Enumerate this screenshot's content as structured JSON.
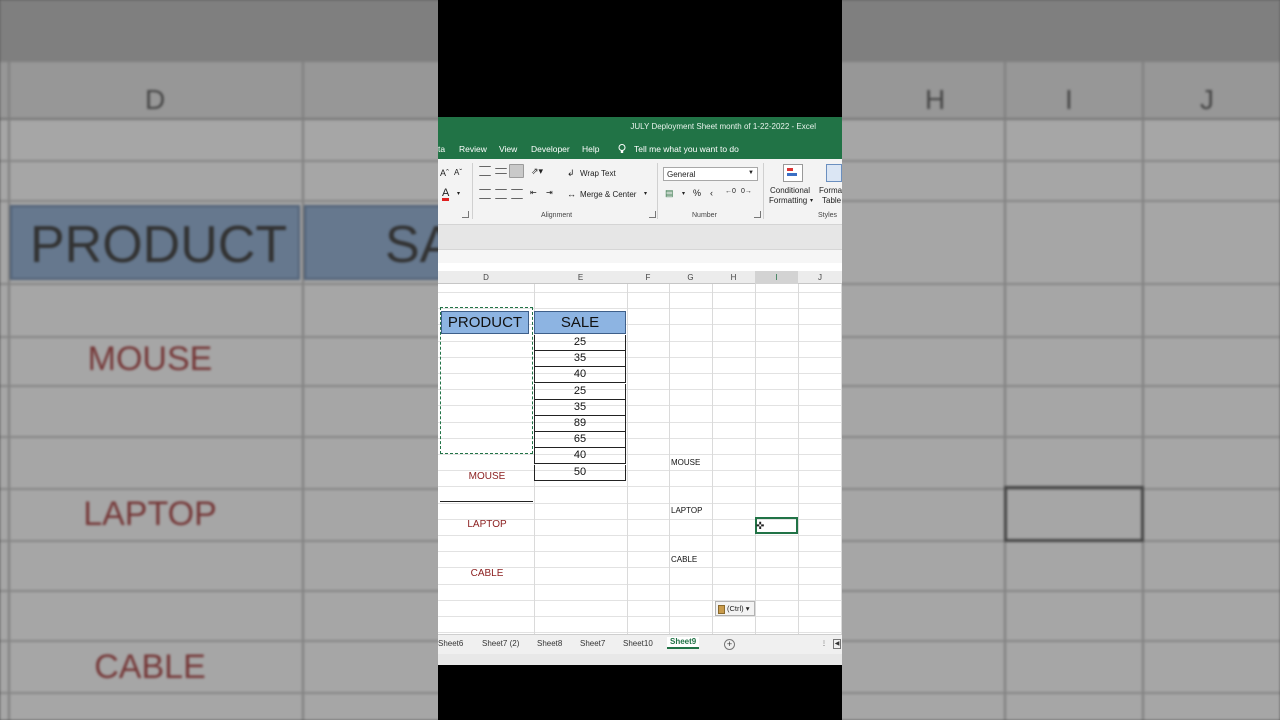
{
  "background": {
    "columns": [
      "D",
      "H",
      "I",
      "J"
    ],
    "header_product": "PRODUCT",
    "header_sale_partial": "SA",
    "items": [
      "MOUSE",
      "LAPTOP",
      "CABLE"
    ]
  },
  "window": {
    "title": "JULY Deployment Sheet month of 1-22-2022 - Excel"
  },
  "ribbon_tabs": [
    "ta",
    "Review",
    "View",
    "Developer",
    "Help"
  ],
  "tell_me": "Tell me what you want to do",
  "ribbon": {
    "wrap_text": "Wrap Text",
    "merge_center": "Merge & Center",
    "number_format": "General",
    "conditional_formatting_1": "Conditional",
    "conditional_formatting_2": "Formatting",
    "format_table_1": "Format",
    "format_table_2": "Table",
    "group_alignment": "Alignment",
    "group_number": "Number",
    "group_styles": "Styles",
    "percent": "%",
    "comma": "‹"
  },
  "columns": [
    "D",
    "E",
    "F",
    "G",
    "H",
    "I",
    "J"
  ],
  "table": {
    "header_product": "PRODUCT",
    "header_sale": "SALE",
    "products": [
      "MOUSE",
      "LAPTOP",
      "CABLE"
    ],
    "sales": [
      "25",
      "35",
      "40",
      "25",
      "35",
      "89",
      "65",
      "40",
      "50"
    ]
  },
  "side_labels": [
    "MOUSE",
    "LAPTOP",
    "CABLE"
  ],
  "paste_options": "(Ctrl)",
  "sheets": [
    "Sheet6",
    "Sheet7 (2)",
    "Sheet8",
    "Sheet7",
    "Sheet10",
    "Sheet9"
  ],
  "active_sheet": "Sheet9",
  "colors": {
    "excel_green": "#217346",
    "header_fill": "#8db4e2",
    "item_text": "#8b1e1e"
  }
}
